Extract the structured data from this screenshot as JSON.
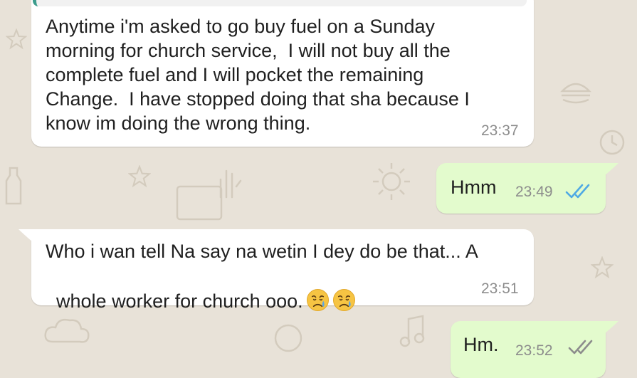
{
  "messages": [
    {
      "direction": "incoming",
      "lines": [
        "Anytime i'm asked to go buy fuel on a Sunday",
        "morning for church service,  I will not buy all the",
        "complete fuel and I will pocket the remaining",
        "Change.  I have stopped doing that sha because I",
        "know im doing the wrong thing."
      ],
      "time": "23:37"
    },
    {
      "direction": "outgoing",
      "text": "Hmm",
      "time": "23:49",
      "status": "read",
      "status_icon": "double-check-icon",
      "status_color": "#4fa9e4"
    },
    {
      "direction": "incoming",
      "lines": [
        "Who i wan tell Na say na wetin I dey do be that... A",
        "whole worker for church ooo."
      ],
      "emojis": [
        "crying-face-emoji",
        "crying-face-emoji"
      ],
      "time": "23:51"
    },
    {
      "direction": "outgoing",
      "text": "Hm.",
      "time": "23:52",
      "status": "delivered",
      "status_icon": "double-check-icon",
      "status_color": "#8c8c8c"
    }
  ],
  "colors": {
    "wallpaper": "#e8e2d8",
    "incoming_bubble": "#ffffff",
    "outgoing_bubble": "#e3fbcd",
    "quote_accent": "#3c9c8c"
  }
}
